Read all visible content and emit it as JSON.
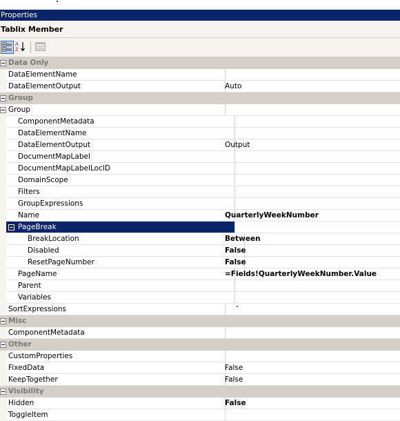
{
  "panel": {
    "title": "Properties",
    "object_name": "Tablix Member"
  },
  "toolbar": {
    "categorized_icon": "categorized-icon",
    "alphabetical_icon": "alphabetical-sort-icon",
    "pages_icon": "property-pages-icon"
  },
  "rows": {
    "cat_data_only": "Data Only",
    "data_element_name": {
      "name": "DataElementName",
      "value": ""
    },
    "data_element_output": {
      "name": "DataElementOutput",
      "value": "Auto"
    },
    "cat_group": "Group",
    "group": {
      "name": "Group",
      "value": ""
    },
    "g_component_metadata": {
      "name": "ComponentMetadata",
      "value": ""
    },
    "g_data_element_name": {
      "name": "DataElementName",
      "value": ""
    },
    "g_data_element_output": {
      "name": "DataElementOutput",
      "value": "Output"
    },
    "g_document_map_label": {
      "name": "DocumentMapLabel",
      "value": ""
    },
    "g_document_map_label_loc_id": {
      "name": "DocumentMapLabelLocID",
      "value": ""
    },
    "g_domain_scope": {
      "name": "DomainScope",
      "value": ""
    },
    "g_filters": {
      "name": "Filters",
      "value": ""
    },
    "g_group_expressions": {
      "name": "GroupExpressions",
      "value": ""
    },
    "g_name": {
      "name": "Name",
      "value": "QuarterlyWeekNumber"
    },
    "g_page_break": {
      "name": "PageBreak",
      "value": ""
    },
    "pb_break_location": {
      "name": "BreakLocation",
      "value": "Between"
    },
    "pb_disabled": {
      "name": "Disabled",
      "value": "False"
    },
    "pb_reset_page_number": {
      "name": "ResetPageNumber",
      "value": "False"
    },
    "g_page_name": {
      "name": "PageName",
      "value": "=Fields!QuarterlyWeekNumber.Value"
    },
    "g_parent": {
      "name": "Parent",
      "value": ""
    },
    "g_variables": {
      "name": "Variables",
      "value": ""
    },
    "sort_expressions": {
      "name": "SortExpressions",
      "value": ""
    },
    "cat_misc": "Misc",
    "component_metadata": {
      "name": "ComponentMetadata",
      "value": ""
    },
    "cat_other": "Other",
    "custom_properties": {
      "name": "CustomProperties",
      "value": ""
    },
    "fixed_data": {
      "name": "FixedData",
      "value": "False"
    },
    "keep_together": {
      "name": "KeepTogether",
      "value": "False"
    },
    "cat_visibility": "Visibility",
    "hidden": {
      "name": "Hidden",
      "value": "False"
    },
    "toggle_item": {
      "name": "ToggleItem",
      "value": ""
    }
  },
  "colors": {
    "title_bar": "#0a246a",
    "category_band": "#d4d0c8",
    "selection": "#0a246a"
  }
}
